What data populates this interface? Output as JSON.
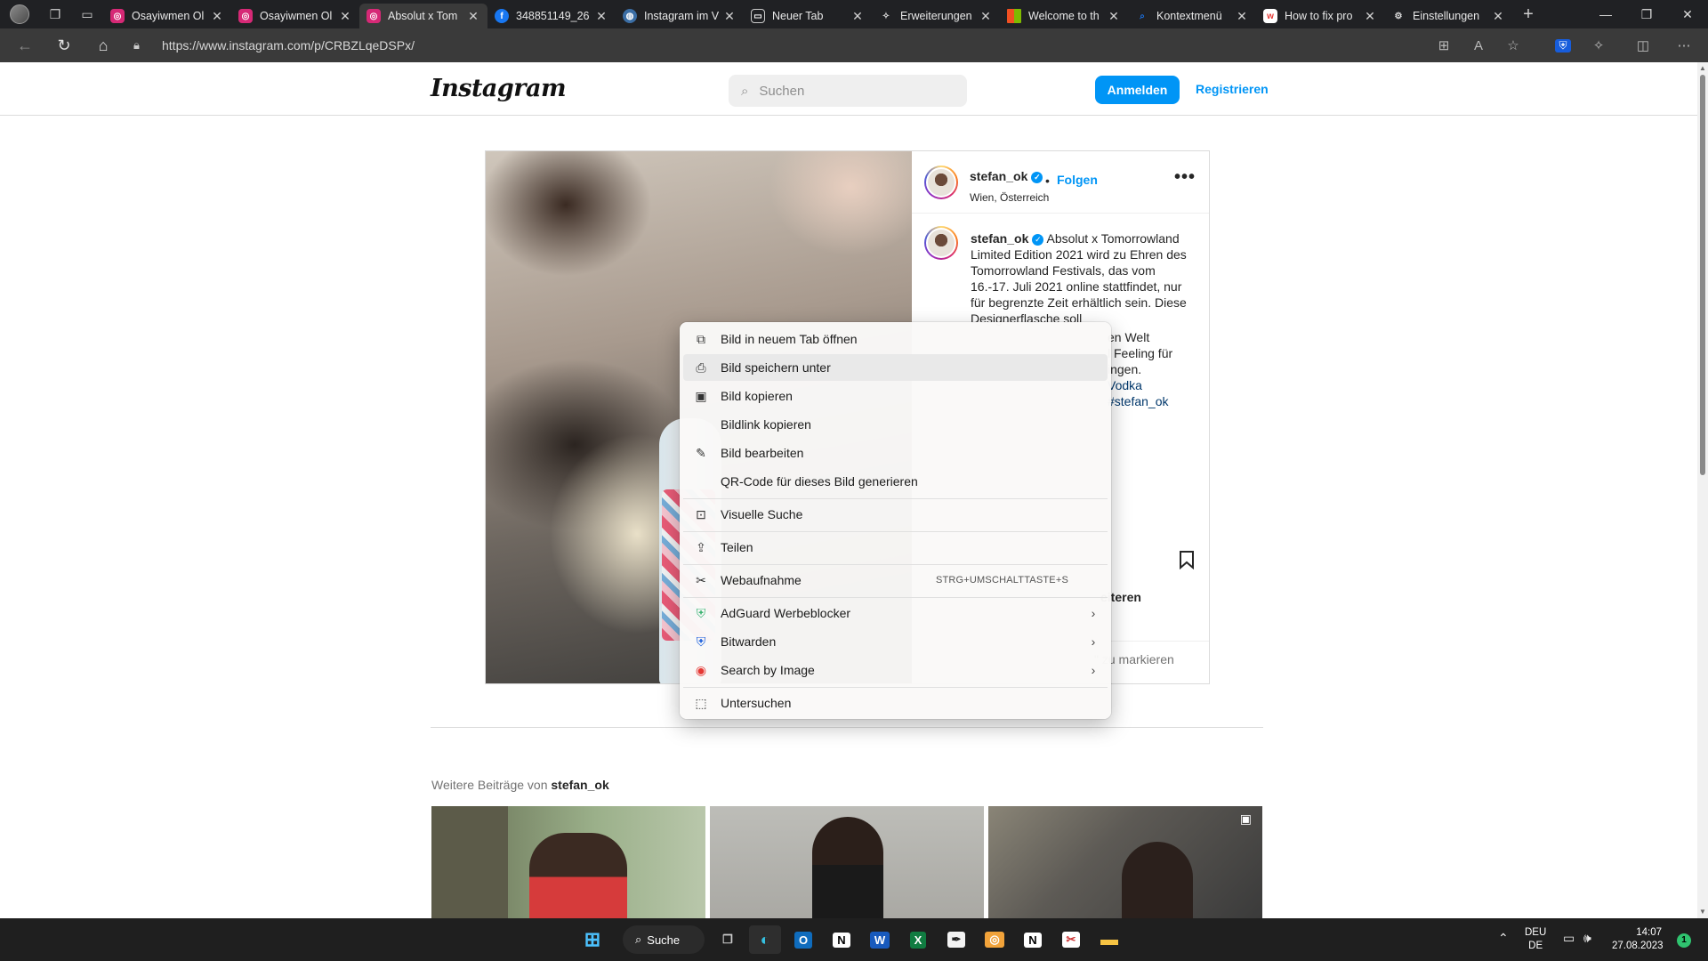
{
  "browser": {
    "tabs": [
      {
        "label": "Osayiwmen Ol",
        "favicon_color": "#d62976",
        "favicon": "ig-icon",
        "active": false
      },
      {
        "label": "Osayiwmen Ol",
        "favicon_color": "#d62976",
        "favicon": "ig-icon",
        "active": false
      },
      {
        "label": "Absolut x Tom",
        "favicon_color": "#d62976",
        "favicon": "ig-icon",
        "active": true
      },
      {
        "label": "348851149_26",
        "favicon_color": "#1877f2",
        "favicon": "facebook-icon",
        "active": false
      },
      {
        "label": "Instagram im V",
        "favicon_color": "#3b6ea5",
        "favicon": "globe-icon",
        "active": false
      },
      {
        "label": "Neuer Tab",
        "favicon_color": "#555555",
        "favicon": "newtab-icon",
        "active": false
      },
      {
        "label": "Erweiterungen",
        "favicon_color": "#555555",
        "favicon": "puzzle-icon",
        "active": false
      },
      {
        "label": "Welcome to th",
        "favicon_color": "#f25022",
        "favicon": "microsoft-icon",
        "active": false
      },
      {
        "label": "Kontextmenü",
        "favicon_color": "#1a73e8",
        "favicon": "search-icon",
        "active": false
      },
      {
        "label": "How to fix pro",
        "favicon_color": "#e53935",
        "favicon": "site-icon",
        "active": false
      },
      {
        "label": "Einstellungen",
        "favicon_color": "#555555",
        "favicon": "gear-icon",
        "active": false
      }
    ],
    "url": "https://www.instagram.com/p/CRBZLqeDSPx/"
  },
  "instagram": {
    "logo": "Instagram",
    "search_placeholder": "Suchen",
    "login": "Anmelden",
    "register": "Registrieren",
    "post": {
      "username": "stefan_ok",
      "follow_sep": "•",
      "follow": "Folgen",
      "location": "Wien, Österreich",
      "more": "•••",
      "caption": "Absolut x Tomorrowland Limited Edition 2021 wird zu Ehren des Tomorrowland Festivals, das vom 16.-17. Juli 2021 online stattfindet, nur für begrenzte Zeit erhältlich sein. Diese Designerflasche soll",
      "caption_tail": [
        "en Welt",
        "l Feeling für",
        "ingen.",
        "Vodka",
        "#stefan_ok"
      ],
      "likes_fragment": "eiteren",
      "comment_fragment": "\" zu markieren"
    },
    "more_posts_prefix": "Weitere Beiträge von",
    "more_posts_user": "stefan_ok"
  },
  "context_menu": {
    "items": [
      {
        "icon": "open-tab-icon",
        "label": "Bild in neuem Tab öffnen"
      },
      {
        "icon": "save-image-icon",
        "label": "Bild speichern unter"
      },
      {
        "icon": "copy-image-icon",
        "label": "Bild kopieren"
      },
      {
        "icon": "",
        "label": "Bildlink kopieren"
      },
      {
        "icon": "edit-image-icon",
        "label": "Bild bearbeiten"
      },
      {
        "icon": "",
        "label": "QR-Code für dieses Bild generieren"
      },
      {
        "icon": "visual-search-icon",
        "label": "Visuelle Suche"
      },
      {
        "icon": "share-icon",
        "label": "Teilen"
      },
      {
        "icon": "web-capture-icon",
        "label": "Webaufnahme",
        "shortcut": "STRG+UMSCHALTTASTE+S"
      },
      {
        "icon": "adguard-icon",
        "label": "AdGuard Werbeblocker"
      },
      {
        "icon": "bitwarden-icon",
        "label": "Bitwarden"
      },
      {
        "icon": "search-by-image-icon",
        "label": "Search by Image"
      },
      {
        "icon": "inspect-icon",
        "label": "Untersuchen"
      }
    ]
  },
  "taskbar": {
    "search_label": "Suche",
    "lang_line1": "DEU",
    "lang_line2": "DE",
    "time": "14:07",
    "date": "27.08.2023",
    "badge": "1"
  }
}
